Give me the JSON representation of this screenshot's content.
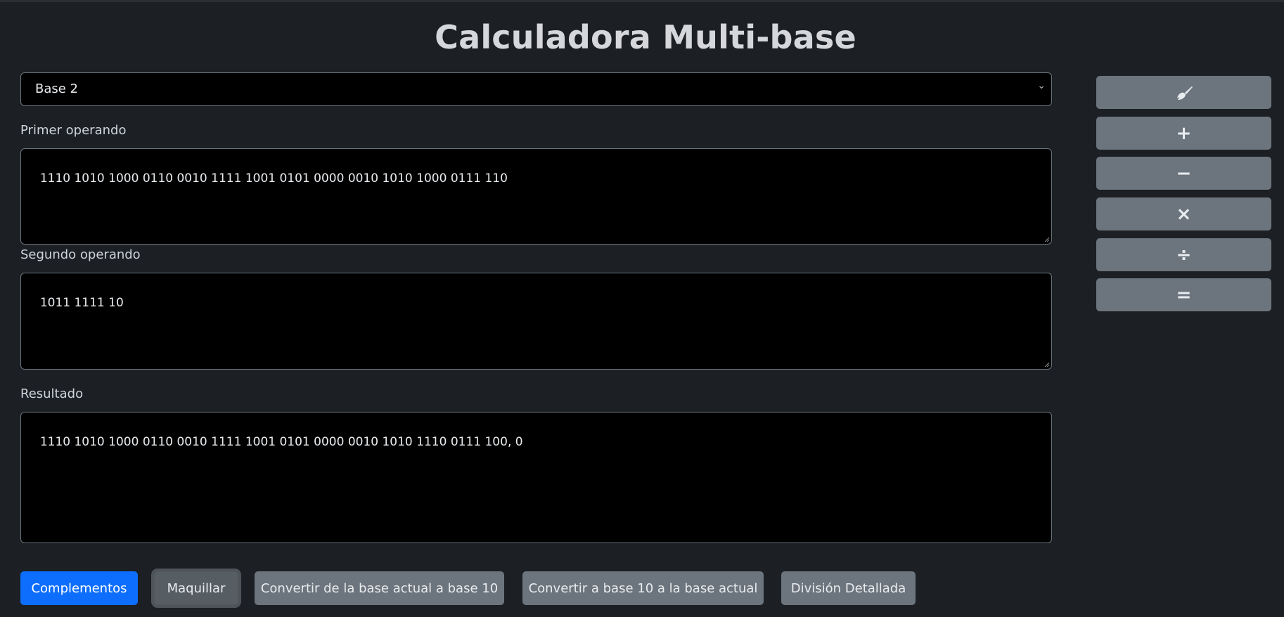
{
  "title": "Calculadora Multi-base",
  "base_select": {
    "value": "Base 2"
  },
  "operand1": {
    "label": "Primer operando",
    "value": "1110 1010 1000 0110 0010 1111 1001 0101 0000 0010 1010 1000 0111 110"
  },
  "operand2": {
    "label": "Segundo operando",
    "value": "1011 1111 10"
  },
  "result": {
    "label": "Resultado",
    "value": "1110 1010 1000 0110 0010 1111 1001 0101 0000 0010 1010 1110 0111 100, 0"
  },
  "side_buttons": [
    {
      "name": "clear-button",
      "icon": "broom-icon",
      "symbol": ""
    },
    {
      "name": "add-button",
      "icon": "plus-icon",
      "symbol": "+"
    },
    {
      "name": "subtract-button",
      "icon": "minus-icon",
      "symbol": "−"
    },
    {
      "name": "multiply-button",
      "icon": "times-icon",
      "symbol": "×"
    },
    {
      "name": "divide-button",
      "icon": "divide-icon",
      "symbol": "÷"
    },
    {
      "name": "equals-button",
      "icon": "equals-icon",
      "symbol": "="
    }
  ],
  "bottom_buttons": {
    "complementos": "Complementos",
    "maquillar": "Maquillar",
    "to_base10": "Convertir de la base actual a base 10",
    "from_base10": "Convertir a base 10 a la base actual",
    "division": "División Detallada"
  },
  "colors": {
    "background": "#1c1f23",
    "primary": "#0d6efd",
    "secondary": "#6c757d"
  }
}
